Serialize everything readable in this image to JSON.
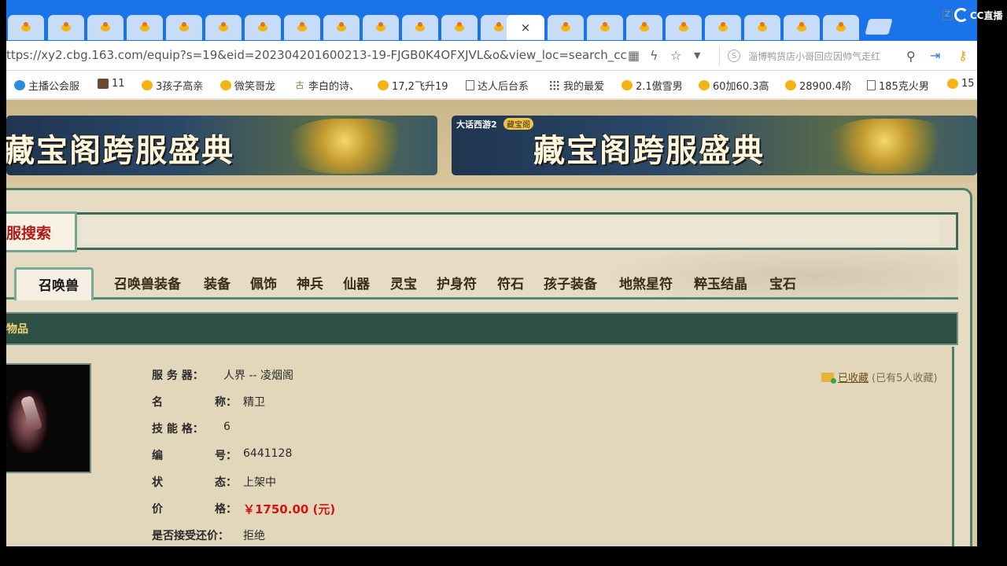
{
  "browser": {
    "url_prefix": "https://",
    "url_domain": "xy2.cbg.163.com",
    "url_path": "/equip?s=19&eid=202304201600213-19-FJGB0K4OFXJVL&o&view_loc=search_cc",
    "url_display": "ttps://xy2.cbg.163.com/equip?s=19&eid=202304201600213-19-FJGB0K4OFXJVL&o&view_loc=search_cc",
    "search_placeholder": "淄博鸭货店小哥回应因帅气走红",
    "tab_close": "×",
    "bookmarks": [
      {
        "label": "主播公会服",
        "icon": "blue"
      },
      {
        "label": "11",
        "icon": "dark"
      },
      {
        "label": "3孩子高亲",
        "icon": "bird"
      },
      {
        "label": "微笑哥龙",
        "icon": "bird"
      },
      {
        "label": "李白的诗、",
        "icon": "gu"
      },
      {
        "label": "17,2飞升19",
        "icon": "bird"
      },
      {
        "label": "达人后台系",
        "icon": "doc"
      },
      {
        "label": "我的最爱",
        "icon": "grid"
      },
      {
        "label": "2.1傲雪男",
        "icon": "bird"
      },
      {
        "label": "60加60.3高",
        "icon": "bird"
      },
      {
        "label": "28900.4阶",
        "icon": "bird"
      },
      {
        "label": "185克火男",
        "icon": "doc"
      },
      {
        "label": "15",
        "icon": "bird"
      }
    ]
  },
  "overlay": {
    "cc_label": "CC直播",
    "cc_small": "Z"
  },
  "banners": [
    {
      "title": "藏宝阁跨服盛典"
    },
    {
      "title": "藏宝阁跨服盛典",
      "logo": "大话西游2",
      "logo2": "藏宝阁"
    }
  ],
  "search": {
    "label": "服搜索"
  },
  "category_tabs": [
    "召唤兽",
    "召唤兽装备",
    "装备",
    "佩饰",
    "神兵",
    "仙器",
    "灵宝",
    "护身符",
    "符石",
    "孩子装备",
    "地煞星符",
    "粹玉结晶",
    "宝石"
  ],
  "section": {
    "title": "物品"
  },
  "item": {
    "server_label": "服 务 器：",
    "server": "人界 -- 凌烟阁",
    "name_label_a": "名",
    "name_label_b": "称：",
    "name": "精卫",
    "skill_label": "技 能 格：",
    "skill": "6",
    "id_label_a": "编",
    "id_label_b": "号：",
    "id": "6441128",
    "status_label_a": "状",
    "status_label_b": "态：",
    "status": "上架中",
    "price_label_a": "价",
    "price_label_b": "格：",
    "price": "￥1750.00 (元)",
    "bargain_label": "是否接受还价：",
    "bargain": "拒绝"
  },
  "favorite": {
    "label": "已收藏",
    "count": "(已有5人收藏)"
  }
}
